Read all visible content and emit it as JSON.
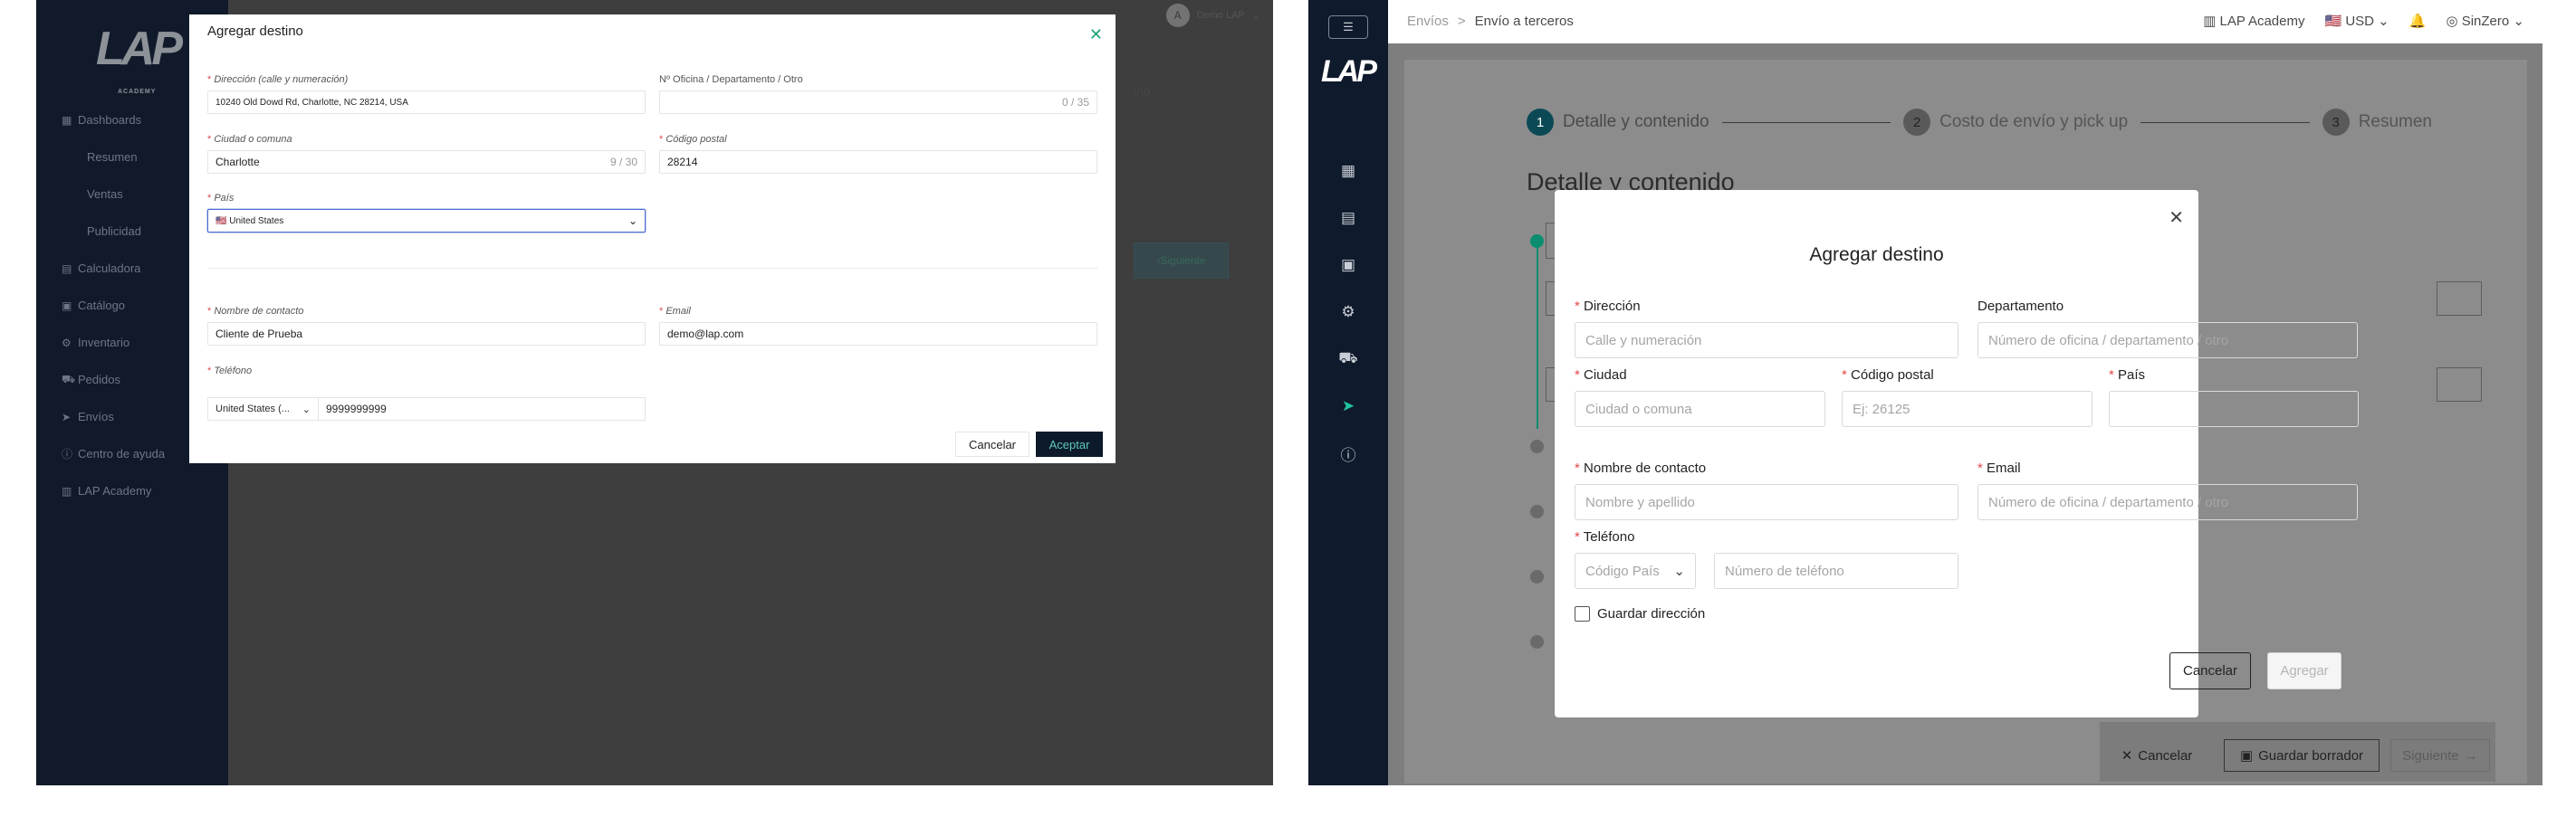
{
  "left": {
    "sidebar": {
      "logo": "LAP",
      "logo_sub": "ACADEMY",
      "items": [
        {
          "icon": "grid-icon",
          "glyph": "▦",
          "label": "Dashboards"
        },
        {
          "icon": "",
          "glyph": "",
          "label": "Resumen",
          "sub": true
        },
        {
          "icon": "",
          "glyph": "",
          "label": "Ventas",
          "sub": true
        },
        {
          "icon": "",
          "glyph": "",
          "label": "Publicidad",
          "sub": true
        },
        {
          "icon": "calculator-icon",
          "glyph": "▤",
          "label": "Calculadora"
        },
        {
          "icon": "catalog-icon",
          "glyph": "▣",
          "label": "Catálogo"
        },
        {
          "icon": "inventory-icon",
          "glyph": "⚙",
          "label": "Inventario"
        },
        {
          "icon": "cart-icon",
          "glyph": "⛟",
          "label": "Pedidos"
        },
        {
          "icon": "send-icon",
          "glyph": "➤",
          "label": "Envíos"
        },
        {
          "icon": "help-icon",
          "glyph": "ⓘ",
          "label": "Centro de ayuda"
        },
        {
          "icon": "academy-icon",
          "glyph": "▥",
          "label": "LAP Academy"
        }
      ]
    },
    "topbar": {
      "user": "Demo LAP",
      "avatar": "A"
    },
    "background": {
      "text": "vío",
      "next_button": "Siguiente"
    },
    "modal": {
      "title": "Agregar destino",
      "direccion_label": "Dirección (calle y numeración)",
      "direccion_value": "10240 Old Dowd Rd, Charlotte, NC 28214, USA",
      "oficina_label": "Nº Oficina / Departamento / Otro",
      "oficina_value": "",
      "oficina_count": "0 / 35",
      "ciudad_label": "Ciudad o comuna",
      "ciudad_value": "Charlotte",
      "ciudad_count": "9 / 30",
      "postal_label": "Código postal",
      "postal_value": "28214",
      "pais_label": "País",
      "pais_value": "🇺🇸 United States",
      "contacto_label": "Nombre de contacto",
      "contacto_value": "Cliente de Prueba",
      "email_label": "Email",
      "email_value": "demo@lap.com",
      "telefono_label": "Teléfono",
      "telefono_code": "United States (...",
      "telefono_value": "9999999999",
      "cancel": "Cancelar",
      "accept": "Aceptar"
    }
  },
  "right": {
    "breadcrumb": {
      "root": "Envíos",
      "sep": ">",
      "current": "Envío a terceros"
    },
    "topbar": {
      "academy": "LAP Academy",
      "currency": "USD",
      "user": "SinZero"
    },
    "steps": [
      {
        "num": "1",
        "label": "Detalle y contenido"
      },
      {
        "num": "2",
        "label": "Costo de envío y pick up"
      },
      {
        "num": "3",
        "label": "Resumen"
      }
    ],
    "section_title": "Detalle y contenido",
    "bg_footer": {
      "cancel": "Cancelar",
      "draft": "Guardar borrador",
      "next": "Siguiente"
    },
    "modal": {
      "title": "Agregar destino",
      "direccion_label": "Dirección",
      "direccion_placeholder": "Calle y numeración",
      "departamento_label": "Departamento",
      "departamento_placeholder": "Número de oficina / departamento / otro",
      "ciudad_label": "Ciudad",
      "ciudad_placeholder": "Ciudad o comuna",
      "postal_label": "Código postal",
      "postal_placeholder": "Ej: 26125",
      "pais_label": "País",
      "pais_placeholder": "",
      "contacto_label": "Nombre de contacto",
      "contacto_placeholder": "Nombre y apellido",
      "email_label": "Email",
      "email_placeholder": "Número de oficina / departamento / otro",
      "telefono_label": "Teléfono",
      "codigo_pais_placeholder": "Código País",
      "telefono_placeholder": "Número de teléfono",
      "guardar_label": "Guardar dirección",
      "cancel": "Cancelar",
      "add": "Agregar"
    }
  },
  "colors": {
    "navy": "#0f1a2c",
    "accent_green": "#1fc59f",
    "required": "#e24a4a"
  }
}
